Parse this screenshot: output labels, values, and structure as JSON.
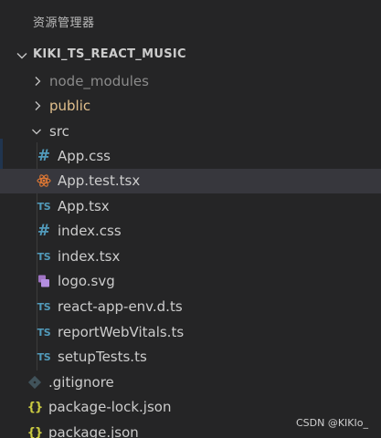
{
  "panel": {
    "title": "资源管理器"
  },
  "project": {
    "name": "KIKI_TS_REACT_MUSIC",
    "expanded": true
  },
  "tree": {
    "node_modules": {
      "label": "node_modules",
      "color": "#8b8b8b"
    },
    "public": {
      "label": "public",
      "color": "#e2c08d"
    },
    "src": {
      "label": "src",
      "color": "#cccccc"
    },
    "app_css": {
      "label": "App.css",
      "icon": "hash-icon"
    },
    "app_test": {
      "label": "App.test.tsx",
      "icon": "react-icon"
    },
    "app_tsx": {
      "label": "App.tsx",
      "icon": "ts-icon"
    },
    "index_css": {
      "label": "index.css",
      "icon": "hash-icon"
    },
    "index_tsx": {
      "label": "index.tsx",
      "icon": "ts-icon"
    },
    "logo_svg": {
      "label": "logo.svg",
      "icon": "svg-icon"
    },
    "react_app_env": {
      "label": "react-app-env.d.ts",
      "icon": "ts-icon"
    },
    "report_web_vitals": {
      "label": "reportWebVitals.ts",
      "icon": "ts-icon"
    },
    "setup_tests": {
      "label": "setupTests.ts",
      "icon": "ts-icon"
    },
    "gitignore": {
      "label": ".gitignore",
      "icon": "git-icon"
    },
    "package_lock": {
      "label": "package-lock.json",
      "icon": "json-icon"
    },
    "package_json": {
      "label": "package.json",
      "icon": "json-icon"
    }
  },
  "icons": {
    "ts_text": "TS",
    "hash_text": "#",
    "json_text": "{}"
  },
  "colors": {
    "background": "#252526",
    "selected_row": "#37373d",
    "ts_blue": "#519aba",
    "json_yellow": "#cbcb41",
    "react_orange": "#e37933",
    "svg_purple": "#a074c4",
    "folder_gold": "#e2c08d"
  },
  "watermark": "CSDN @KIKIo_"
}
